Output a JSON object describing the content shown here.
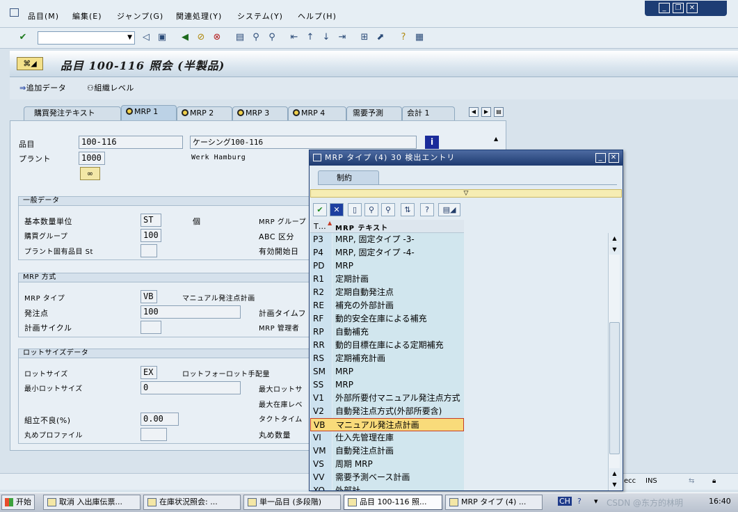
{
  "menubar": {
    "items": [
      "品目(M)",
      "編集(E)",
      "ジャンプ(G)",
      "関連処理(Y)",
      "システム(Y)",
      "ヘルプ(H)"
    ]
  },
  "title": "品目 100-116 照会 (半製品)",
  "app_toolbar": {
    "additional_data": "追加データ",
    "org_levels": "組織レベル"
  },
  "tabs": [
    {
      "label": "購買発注テキスト",
      "active": false,
      "icon": "none"
    },
    {
      "label": "MRP 1",
      "active": true,
      "icon": "status-dot-icon"
    },
    {
      "label": "MRP 2",
      "active": false,
      "icon": "status-dot-icon"
    },
    {
      "label": "MRP 3",
      "active": false,
      "icon": "status-dot-icon"
    },
    {
      "label": "MRP 4",
      "active": false,
      "icon": "status-dot-icon"
    },
    {
      "label": "需要予測",
      "active": false,
      "icon": "none"
    },
    {
      "label": "会計 1",
      "active": false,
      "icon": "none"
    }
  ],
  "header": {
    "material_label": "品目",
    "material_value": "100-116",
    "material_desc": "ケーシング100-116",
    "plant_label": "プラント",
    "plant_value": "1000",
    "plant_name": "Werk Hamburg"
  },
  "general": {
    "title": "一般データ",
    "base_uom_label": "基本数量単位",
    "base_uom_value": "ST",
    "base_uom_text": "個",
    "mrp_group_label": "MRP グループ",
    "purch_group_label": "購買グループ",
    "purch_group_value": "100",
    "abc_label": "ABC 区分",
    "plant_status_label": "プラント固有品目 St",
    "plant_status_value": "",
    "valid_from_label": "有効開始日"
  },
  "mrp_proc": {
    "title": "MRP 方式",
    "mrp_type_label": "MRP タイプ",
    "mrp_type_value": "VB",
    "mrp_type_text": "マニュアル発注点計画",
    "reorder_label": "発注点",
    "reorder_value": "100",
    "time_fence_label": "計画タイムフ",
    "planning_cycle_label": "計画サイクル",
    "planning_cycle_value": "",
    "controller_label": "MRP 管理者"
  },
  "lot_size": {
    "title": "ロットサイズデータ",
    "lot_size_label": "ロットサイズ",
    "lot_size_value": "EX",
    "lot_size_text": "ロットフォーロット手配量",
    "min_lot_label": "最小ロットサイズ",
    "min_lot_value": "0",
    "max_lot_label": "最大ロットサ",
    "max_stock_label": "最大在庫レベ",
    "assembly_scrap_label": "組立不良(%)",
    "assembly_scrap_value": "0.00",
    "takt_label": "タクトタイム",
    "rounding_profile_label": "丸めプロファイル",
    "rounding_profile_value": "",
    "rounding_qty_label": "丸め数量"
  },
  "popup": {
    "title": "MRP タイプ (4)   30 検出エントリ",
    "restrictions_tab": "制約",
    "col_type": "T…",
    "col_text": "MRP テキスト",
    "rows": [
      {
        "code": "P3",
        "text": "MRP, 固定タイプ -3-"
      },
      {
        "code": "P4",
        "text": "MRP, 固定タイプ -4-"
      },
      {
        "code": "PD",
        "text": "MRP"
      },
      {
        "code": "R1",
        "text": "定期計画"
      },
      {
        "code": "R2",
        "text": "定期自動発注点"
      },
      {
        "code": "RE",
        "text": "補充の外部計画"
      },
      {
        "code": "RF",
        "text": "動的安全在庫による補充"
      },
      {
        "code": "RP",
        "text": "自動補充"
      },
      {
        "code": "RR",
        "text": "動的目標在庫による定期補充"
      },
      {
        "code": "RS",
        "text": "定期補充計画"
      },
      {
        "code": "SM",
        "text": "MRP"
      },
      {
        "code": "SS",
        "text": "MRP"
      },
      {
        "code": "V1",
        "text": "外部所要付マニュアル発注点方式"
      },
      {
        "code": "V2",
        "text": "自動発注点方式(外部所要含)"
      },
      {
        "code": "VB",
        "text": "マニュアル発注点計画"
      },
      {
        "code": "VI",
        "text": "仕入先管理在庫"
      },
      {
        "code": "VM",
        "text": "自動発注点計画"
      },
      {
        "code": "VS",
        "text": "周期 MRP"
      },
      {
        "code": "VV",
        "text": "需要予測ベース計画"
      },
      {
        "code": "XO",
        "text": "外部計"
      }
    ],
    "selected_code": "VB"
  },
  "statusbar": {
    "system": "ecc",
    "mode": "INS"
  },
  "taskbar": {
    "start": "开始",
    "tasks": [
      "取消 入出庫伝票...",
      "在庫状況照会: ...",
      "単一品目 (多段階)",
      "品目 100-116 照...",
      "MRP タイプ (4) ..."
    ],
    "ime": "CH",
    "watermark": "CSDN @东方的林明",
    "clock": "16:40"
  },
  "colors": {
    "selected_row": "#f9db7a",
    "popup_title": "#1f3b70",
    "code_column": "#cde2ef"
  }
}
